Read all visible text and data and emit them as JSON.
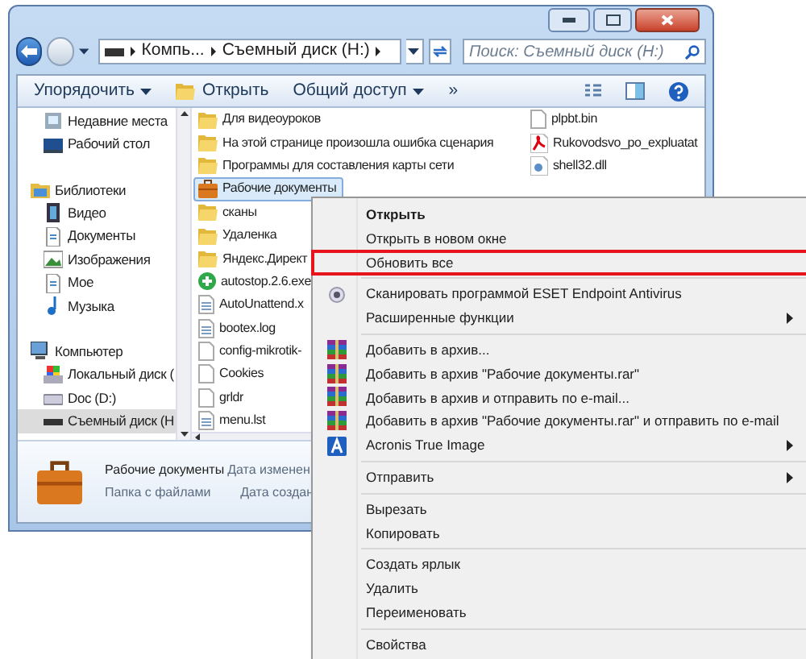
{
  "window": {
    "address": [
      "Компь...",
      "Съемный диск (H:)"
    ],
    "search": {
      "placeholder": "Поиск: Съемный диск (H:)"
    }
  },
  "toolbar": [
    {
      "label": "Упорядочить",
      "kind": "dropdown"
    },
    {
      "label": "Открыть",
      "kind": "open"
    },
    {
      "label": "Общий доступ",
      "kind": "dropdown"
    },
    {
      "label": "»",
      "kind": "more"
    }
  ],
  "nav": [
    {
      "label": "Недавние места",
      "kind": "recent",
      "selected": false
    },
    {
      "label": "Рабочий стол",
      "kind": "desktop",
      "selected": false
    },
    {
      "label": "Библиотеки",
      "kind": "library",
      "selected": false,
      "children": [
        {
          "label": "Видео",
          "kind": "video",
          "selected": false
        },
        {
          "label": "Документы",
          "kind": "docs",
          "selected": false
        },
        {
          "label": "Изображения",
          "kind": "images",
          "selected": false
        },
        {
          "label": "Мое",
          "kind": "docs",
          "selected": false
        },
        {
          "label": "Музыка",
          "kind": "music",
          "selected": false
        }
      ]
    },
    {
      "label": "Компьютер",
      "kind": "computer",
      "selected": false,
      "children": [
        {
          "label": "Локальный диск (",
          "kind": "windrive",
          "selected": false
        },
        {
          "label": "Doc (D:)",
          "kind": "drive",
          "selected": false
        },
        {
          "label": "Съемный диск (H",
          "kind": "usb",
          "selected": true
        }
      ]
    }
  ],
  "files": [
    [
      {
        "name": "Для видеоуроков",
        "kind": "folder",
        "selected": false
      },
      {
        "name": "На этой странице произошла ошибка сценария",
        "kind": "folder",
        "selected": false
      },
      {
        "name": "Программы для составления карты сети",
        "kind": "folder",
        "selected": false
      },
      {
        "name": "Рабочие документы",
        "kind": "briefcase",
        "selected": true
      },
      {
        "name": "сканы",
        "kind": "folder",
        "selected": false
      },
      {
        "name": "Удаленка",
        "kind": "folder",
        "selected": false
      },
      {
        "name": "Яндекс.Директ",
        "kind": "folder",
        "selected": false
      },
      {
        "name": "autostop.2.6.exe",
        "kind": "exe",
        "selected": false
      },
      {
        "name": "AutoUnattend.x",
        "kind": "xml",
        "selected": false
      },
      {
        "name": "bootex.log",
        "kind": "text",
        "selected": false
      },
      {
        "name": "config-mikrotik-",
        "kind": "file",
        "selected": false
      },
      {
        "name": "Cookies",
        "kind": "file",
        "selected": false
      },
      {
        "name": "grldr",
        "kind": "file",
        "selected": false
      },
      {
        "name": "menu.lst",
        "kind": "text",
        "selected": false
      }
    ],
    [
      {
        "name": "plpbt.bin",
        "kind": "file",
        "selected": false
      },
      {
        "name": "Rukovodsvo_po_expluatat",
        "kind": "pdf",
        "selected": false
      },
      {
        "name": "shell32.dll",
        "kind": "dll",
        "selected": false
      }
    ]
  ],
  "details": {
    "title": "Рабочие документы",
    "type": "Папка с файлами",
    "fields": [
      "Дата изменен",
      "Дата создан"
    ]
  },
  "context_menu": [
    {
      "kind": "plain",
      "label": "Открыть",
      "bold": true,
      "submenu": false,
      "outlined": false
    },
    {
      "kind": "plain",
      "label": "Открыть в новом окне",
      "bold": false,
      "submenu": false,
      "outlined": false
    },
    {
      "kind": "plain",
      "label": "Обновить все",
      "bold": false,
      "submenu": false,
      "outlined": true
    },
    {
      "kind": "separator"
    },
    {
      "kind": "scan",
      "label": "Сканировать программой ESET Endpoint Antivirus",
      "bold": false,
      "submenu": false,
      "outlined": false
    },
    {
      "kind": "plain",
      "label": "Расширенные функции",
      "bold": false,
      "submenu": true,
      "outlined": false
    },
    {
      "kind": "separator"
    },
    {
      "kind": "archive",
      "label": "Добавить в архив...",
      "bold": false,
      "submenu": false,
      "outlined": false
    },
    {
      "kind": "archive",
      "label": "Добавить в архив \"Рабочие документы.rar\"",
      "bold": false,
      "submenu": false,
      "outlined": false
    },
    {
      "kind": "archive",
      "label": "Добавить в архив и отправить по e-mail...",
      "bold": false,
      "submenu": false,
      "outlined": false
    },
    {
      "kind": "archive",
      "label": "Добавить в архив \"Рабочие документы.rar\" и отправить по e-mail",
      "bold": false,
      "submenu": false,
      "outlined": false
    },
    {
      "kind": "backup",
      "label": "Acronis True Image",
      "bold": false,
      "submenu": true,
      "outlined": false
    },
    {
      "kind": "separator"
    },
    {
      "kind": "plain",
      "label": "Отправить",
      "bold": false,
      "submenu": true,
      "outlined": false
    },
    {
      "kind": "separator"
    },
    {
      "kind": "plain",
      "label": "Вырезать",
      "bold": false,
      "submenu": false,
      "outlined": false
    },
    {
      "kind": "plain",
      "label": "Копировать",
      "bold": false,
      "submenu": false,
      "outlined": false
    },
    {
      "kind": "separator"
    },
    {
      "kind": "plain",
      "label": "Создать ярлык",
      "bold": false,
      "submenu": false,
      "outlined": false
    },
    {
      "kind": "plain",
      "label": "Удалить",
      "bold": false,
      "submenu": false,
      "outlined": false
    },
    {
      "kind": "plain",
      "label": "Переименовать",
      "bold": false,
      "submenu": false,
      "outlined": false
    },
    {
      "kind": "separator"
    },
    {
      "kind": "plain",
      "label": "Свойства",
      "bold": false,
      "submenu": false,
      "outlined": false
    }
  ]
}
